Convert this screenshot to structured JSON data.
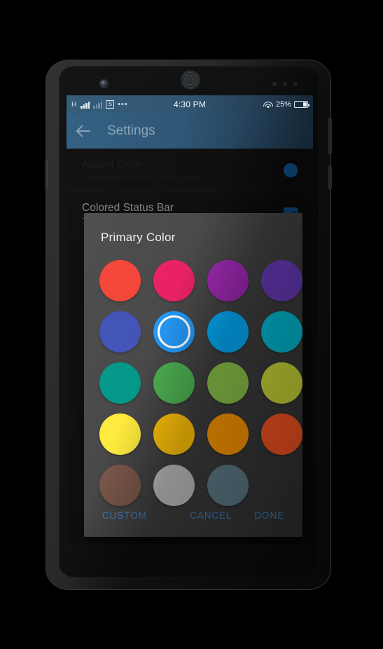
{
  "status_bar": {
    "network_label": "H",
    "sim_label": "S",
    "overflow_dots": "•••",
    "time": "4:30 PM",
    "battery_percent": "25%",
    "icons": [
      "signal-icon",
      "signal-secondary-icon",
      "sim-card-icon",
      "more-icon",
      "wifi-icon",
      "battery-icon"
    ]
  },
  "toolbar": {
    "back_icon": "arrow-back-icon",
    "title": "Settings"
  },
  "background_prefs": [
    {
      "title": "Accent Color",
      "subtitle": "Change the accent theme color",
      "swatch_color": "#1b74c4",
      "dimmed": true
    },
    {
      "title": "Colored Status Bar",
      "subtitle": "Toggle status bar coloring",
      "checked": true,
      "checkbox_color": "#1b74c4",
      "dimmed": false
    }
  ],
  "dialog": {
    "title": "Primary Color",
    "selected_index": 5,
    "swatches": [
      {
        "name": "red",
        "hex": "#F44336"
      },
      {
        "name": "pink",
        "hex": "#E91E63"
      },
      {
        "name": "purple",
        "hex": "#9C27B0"
      },
      {
        "name": "deep-purple",
        "hex": "#673AB7"
      },
      {
        "name": "indigo",
        "hex": "#3F51B5"
      },
      {
        "name": "blue",
        "hex": "#2196F3"
      },
      {
        "name": "light-blue",
        "hex": "#03A9F4"
      },
      {
        "name": "cyan",
        "hex": "#00BCD4"
      },
      {
        "name": "teal",
        "hex": "#009688"
      },
      {
        "name": "green",
        "hex": "#4CAF50"
      },
      {
        "name": "light-green",
        "hex": "#8BC34A"
      },
      {
        "name": "lime",
        "hex": "#CDDC39"
      },
      {
        "name": "yellow",
        "hex": "#FFEB3B"
      },
      {
        "name": "amber",
        "hex": "#FFC107"
      },
      {
        "name": "orange",
        "hex": "#FF9800"
      },
      {
        "name": "deep-orange",
        "hex": "#FF5722"
      },
      {
        "name": "brown",
        "hex": "#795548"
      },
      {
        "name": "grey",
        "hex": "#BDBDBD"
      },
      {
        "name": "blue-grey",
        "hex": "#607D8B"
      }
    ],
    "buttons": {
      "custom": "CUSTOM",
      "cancel": "CANCEL",
      "done": "DONE"
    },
    "button_color": "#3f7fbf"
  }
}
